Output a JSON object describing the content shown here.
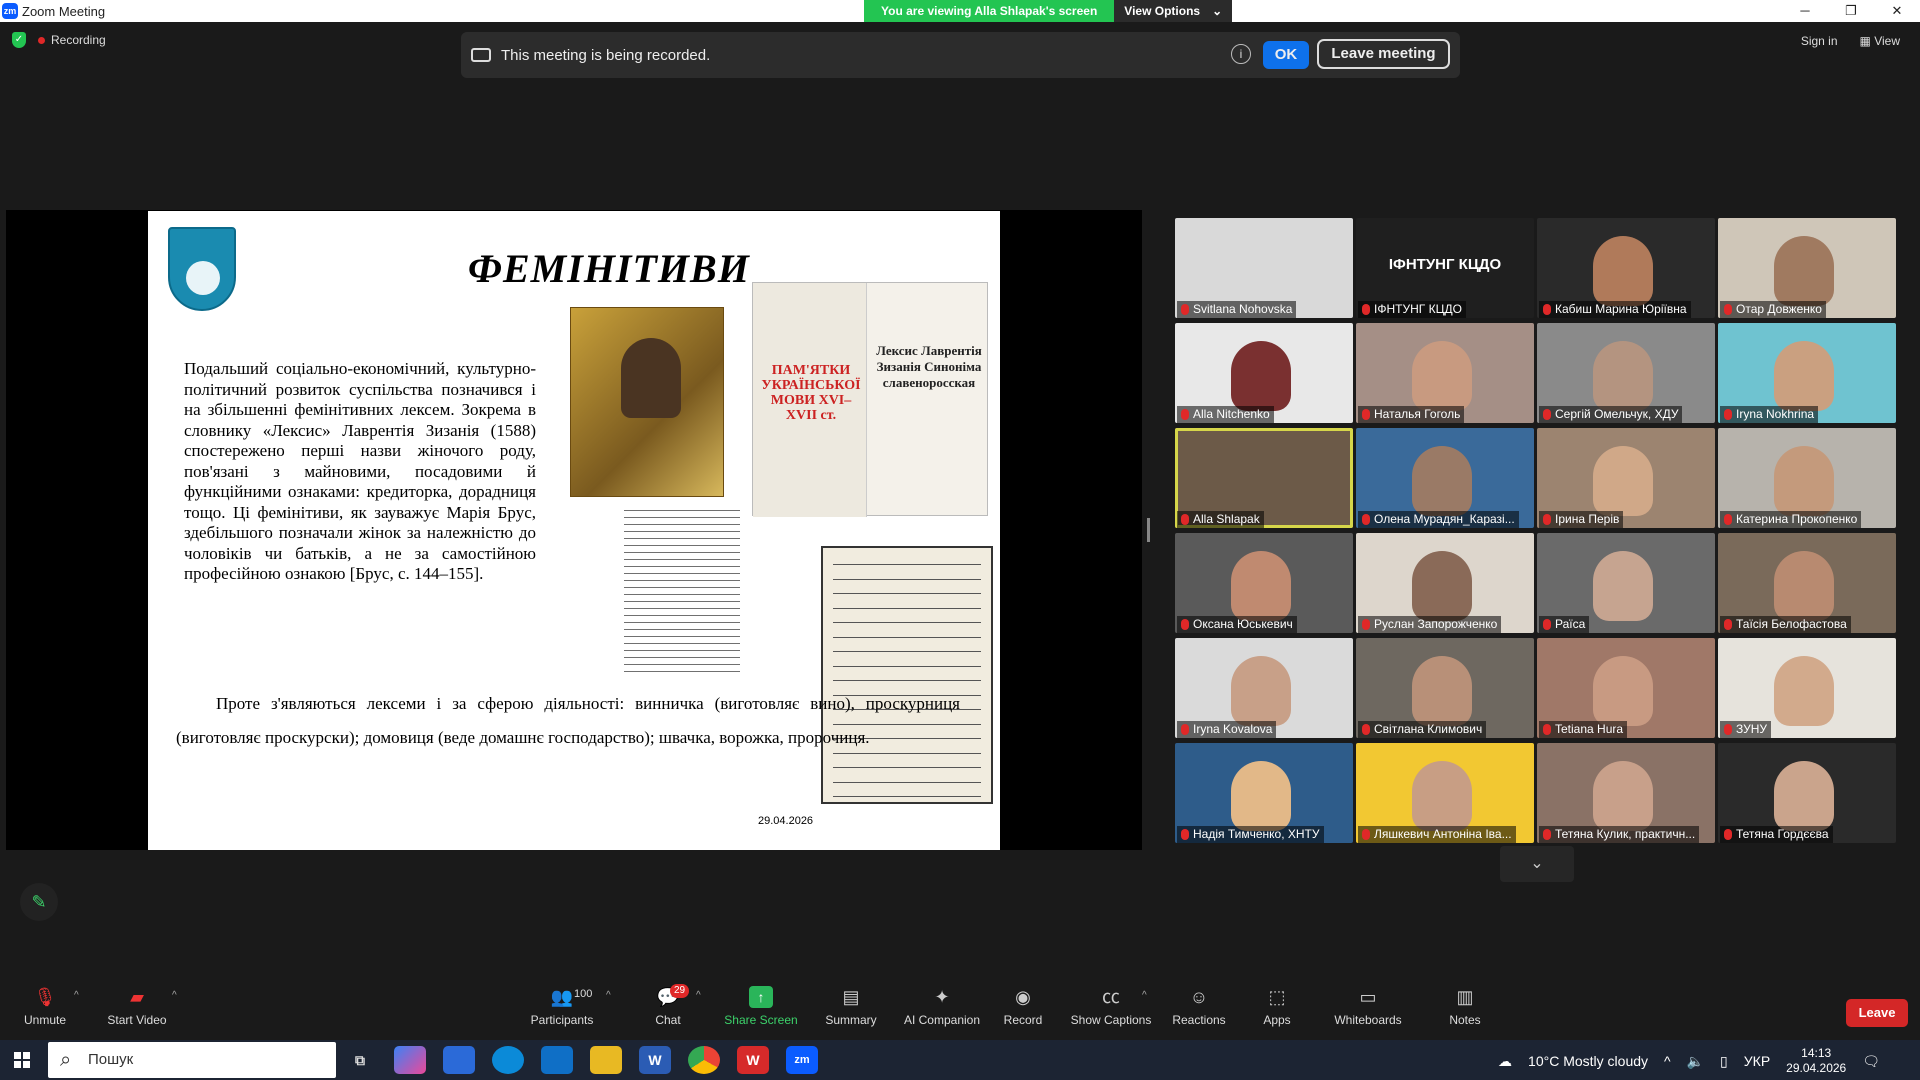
{
  "window": {
    "title": "Zoom Meeting",
    "app_icon": "zm"
  },
  "viewing": {
    "text": "You are viewing Alla Shlapak's screen",
    "options_label": "View Options"
  },
  "status": {
    "recording_label": "Recording"
  },
  "banner": {
    "text": "This meeting is being recorded.",
    "info": "i",
    "ok_label": "OK",
    "leave_label": "Leave meeting"
  },
  "top_right": {
    "sign_in": "Sign in",
    "view": "View"
  },
  "slide": {
    "title": "ФЕМІНІТИВИ",
    "paragraph1": "Подальший соціально-економічний, культурно-політичний розвиток суспільства позначився і на збільшенні фемінітивних лексем. Зокрема в словнику «Лексис» Лаврентія Зизанія (1588) спостережено перші назви жіночого роду, пов'язані з майновими, посадовими й функційними ознаками: кредиторка, дорадниця тощо. Ці фемінітиви, як зауважує Марія Брус, здебільшого позначали жінок за належністю до чоловіків чи батьків, а не за самостійною професійною ознакою [Брус, с. 144–155].",
    "paragraph2": "Проте з'являються лексеми і за сферою діяльності: винничка (виготовляє вино), проскурниця (виготовляє проскурски); домовиця (веде домашнє господарство); швачка, ворожка, пророчиця.",
    "book_left": "ПАМ'ЯТКИ УКРАЇНСЬКОЇ МОВИ XVI–XVII ст.",
    "book_right": "Лексис Лаврентія Зизанія Синоніма славеноросская",
    "date": "29.04.2026"
  },
  "participants": [
    {
      "name": "Svitlana Nohovska",
      "bg": "#d9d9d9",
      "face": ""
    },
    {
      "name": "ІФНТУНГ КЦДО",
      "bg": "#1f1f1f",
      "face": "",
      "center": "ІФНТУНГ КЦДО"
    },
    {
      "name": "Кабиш Марина Юріївна",
      "bg": "#2a2a2a",
      "face": "#b07a5a"
    },
    {
      "name": "Отар Довженко",
      "bg": "#cfc6b8",
      "face": "#a07a60"
    },
    {
      "name": "Alla Nitchenko",
      "bg": "#e8e8e8",
      "face": "#7a3030"
    },
    {
      "name": "Наталья Гоголь",
      "bg": "#a58f86",
      "face": "#c89a80"
    },
    {
      "name": "Сергій Омельчук, ХДУ",
      "bg": "#8a8a8a",
      "face": "#b49480"
    },
    {
      "name": "Iryna Nokhrina",
      "bg": "#6fc3d0",
      "face": "#caa080"
    },
    {
      "name": "Alla Shlapak",
      "bg": "#6c5a48",
      "face": "",
      "active": true
    },
    {
      "name": "Олена Мурадян_Каразі...",
      "bg": "#3a6a9a",
      "face": "#9a7a66"
    },
    {
      "name": "Ірина Перів",
      "bg": "#9c8470",
      "face": "#d0a888"
    },
    {
      "name": "Катерина Прокопенко",
      "bg": "#b7b3ac",
      "face": "#c49a7c"
    },
    {
      "name": "Оксана Юськевич",
      "bg": "#5a5a5a",
      "face": "#c08a70"
    },
    {
      "name": "Руслан Запорожченко",
      "bg": "#ddd6cc",
      "face": "#8a6a58"
    },
    {
      "name": "Раїса",
      "bg": "#6a6a6a",
      "face": "#c6a490"
    },
    {
      "name": "Таїсія Белофастова",
      "bg": "#7a6a5a",
      "face": "#b88a70"
    },
    {
      "name": "Iryna Kovalova",
      "bg": "#dadada",
      "face": "#c8a088"
    },
    {
      "name": "Світлана Климович",
      "bg": "#6e6860",
      "face": "#b89078"
    },
    {
      "name": "Tetiana Hura",
      "bg": "#a07868",
      "face": "#c89a82"
    },
    {
      "name": "ЗУНУ",
      "bg": "#e6e3dc",
      "face": "#d2aa8c"
    },
    {
      "name": "Надія Тимченко, ХНТУ",
      "bg": "#2e5c8a",
      "face": "#e2b888"
    },
    {
      "name": "Ляшкевич Антоніна Іва...",
      "bg": "#f2c832",
      "face": "#c89e84"
    },
    {
      "name": "Тетяна Кулик, практичн...",
      "bg": "#8a7266",
      "face": "#c8a08a"
    },
    {
      "name": "Тетяна Гордєєва",
      "bg": "#2a2a2a",
      "face": "#caa48c"
    }
  ],
  "more_label": "⌄",
  "toolbar": {
    "unmute": "Unmute",
    "start_video": "Start Video",
    "participants": "Participants",
    "participants_count": "100",
    "chat": "Chat",
    "chat_badge": "29",
    "share_screen": "Share Screen",
    "summary": "Summary",
    "ai_companion": "AI Companion",
    "record": "Record",
    "show_captions": "Show Captions",
    "reactions": "Reactions",
    "apps": "Apps",
    "whiteboards": "Whiteboards",
    "notes": "Notes",
    "leave": "Leave"
  },
  "taskbar": {
    "search_placeholder": "Пошук",
    "weather": "10°C  Mostly cloudy",
    "lang": "УКР",
    "time": "14:13",
    "date": "29.04.2026"
  }
}
